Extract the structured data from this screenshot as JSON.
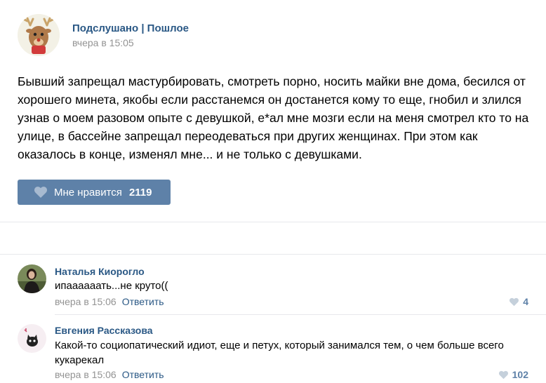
{
  "post": {
    "author": "Подслушано | Пошлое",
    "time": "вчера в 15:05",
    "text": "Бывший запрещал мастурбировать, смотреть порно, носить майки вне дома, бесился от хорошего минета, якобы если расстанемся он достанется кому то еще, гнобил и злился узнав о моем разовом опыте с девушкой, е*ал мне мозги если на меня смотрел кто то на улице, в бассейне запрещал переодеваться при других женщинах. При этом как оказалось в конце, изменял мне... и не только с девушками.",
    "like_label": "Мне нравится",
    "like_count": "2119"
  },
  "comments": [
    {
      "author": "Наталья Киорогло",
      "text": "ипаааааать...не круто((",
      "time": "вчера в 15:06",
      "reply_label": "Ответить",
      "likes": "4"
    },
    {
      "author": "Евгения Рассказова",
      "text": "Какой-то социопатический идиот, еще и петух, который занимался тем, о чем больше всего кукарекал",
      "time": "вчера в 15:06",
      "reply_label": "Ответить",
      "likes": "102"
    }
  ],
  "colors": {
    "link": "#2a5885",
    "button": "#5e81a8",
    "muted": "#939393",
    "divider": "#e7e8ec"
  },
  "icons": {
    "like_button": "heart-icon",
    "comment_likes": "heart-icon"
  }
}
